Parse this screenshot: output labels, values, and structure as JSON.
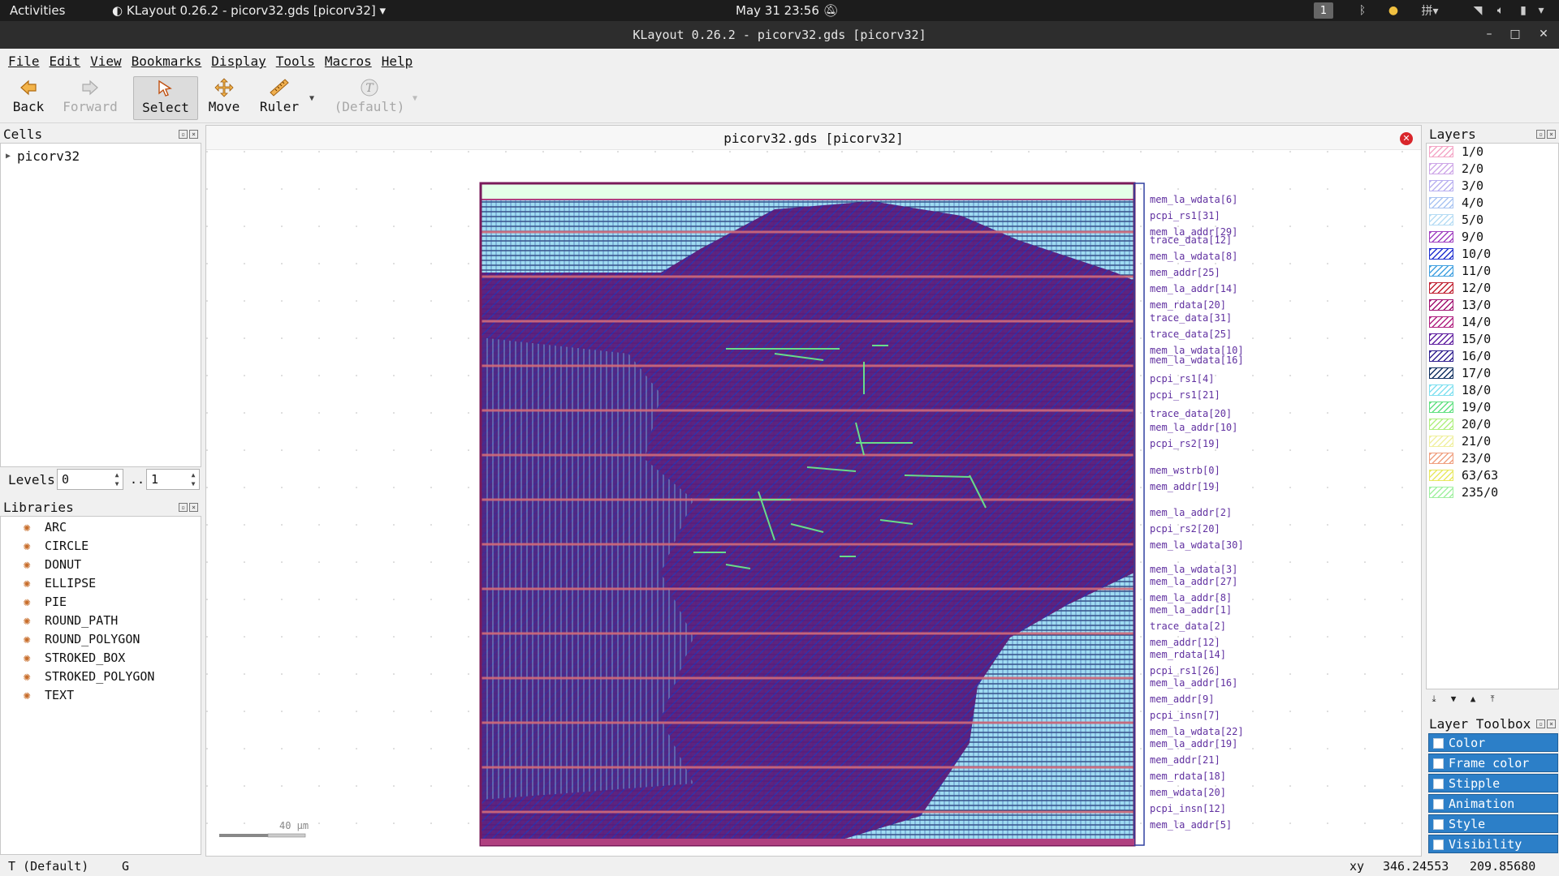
{
  "topbar": {
    "activities": "Activities",
    "app_name": "KLayout 0.26.2 - picorv32.gds [picorv32]",
    "clock": "May 31 23:56",
    "workspace": "1"
  },
  "window": {
    "title": "KLayout 0.26.2 - picorv32.gds [picorv32]"
  },
  "menu": [
    {
      "label": "File"
    },
    {
      "label": "Edit"
    },
    {
      "label": "View"
    },
    {
      "label": "Bookmarks"
    },
    {
      "label": "Display"
    },
    {
      "label": "Tools"
    },
    {
      "label": "Macros"
    },
    {
      "label": "Help"
    }
  ],
  "toolbar": {
    "back": "Back",
    "forward": "Forward",
    "select": "Select",
    "move": "Move",
    "ruler": "Ruler",
    "default": "(Default)"
  },
  "cells": {
    "title": "Cells",
    "items": [
      "picorv32"
    ]
  },
  "levels": {
    "label": "Levels",
    "from": "0",
    "sep": "..",
    "to": "1"
  },
  "libraries": {
    "title": "Libraries",
    "items": [
      "ARC",
      "CIRCLE",
      "DONUT",
      "ELLIPSE",
      "PIE",
      "ROUND_PATH",
      "ROUND_POLYGON",
      "STROKED_BOX",
      "STROKED_POLYGON",
      "TEXT"
    ]
  },
  "view": {
    "title": "picorv32.gds [picorv32]",
    "scale_label": "40 µm",
    "pin_labels": [
      "mem_la_wdata[6]",
      "pcpi_rs1[31]",
      "mem_la_addr[29]",
      "trace_data[12]",
      "mem_la_wdata[8]",
      "mem_addr[25]",
      "mem_la_addr[14]",
      "mem_rdata[20]",
      "trace_data[31]",
      "trace_data[25]",
      "mem_la_wdata[10]",
      "mem_la_wdata[16]",
      "pcpi_rs1[4]",
      "pcpi_rs1[21]",
      "trace_data[20]",
      "mem_la_addr[10]",
      "pcpi_rs2[19]",
      "mem_wstrb[0]",
      "mem_addr[19]",
      "mem_la_addr[2]",
      "pcpi_rs2[20]",
      "mem_la_wdata[30]",
      "mem_la_wdata[3]",
      "mem_la_addr[27]",
      "mem_la_addr[8]",
      "mem_la_addr[1]",
      "trace_data[2]",
      "mem_addr[12]",
      "mem_rdata[14]",
      "pcpi_rs1[26]",
      "mem_la_addr[16]",
      "mem_addr[9]",
      "pcpi_insn[7]",
      "mem_la_wdata[22]",
      "mem_la_addr[19]",
      "mem_addr[21]",
      "mem_rdata[18]",
      "mem_wdata[20]",
      "pcpi_insn[12]",
      "mem_la_addr[5]"
    ]
  },
  "layers": {
    "title": "Layers",
    "items": [
      {
        "name": "1/0",
        "color": "#f4a6c6"
      },
      {
        "name": "2/0",
        "color": "#cfa8e8"
      },
      {
        "name": "3/0",
        "color": "#b9b0f0"
      },
      {
        "name": "4/0",
        "color": "#a9c4f2"
      },
      {
        "name": "5/0",
        "color": "#b6dcf4"
      },
      {
        "name": "9/0",
        "color": "#a040c0"
      },
      {
        "name": "10/0",
        "color": "#2030d0"
      },
      {
        "name": "11/0",
        "color": "#40a0e0"
      },
      {
        "name": "12/0",
        "color": "#c02030"
      },
      {
        "name": "13/0",
        "color": "#a01070"
      },
      {
        "name": "14/0",
        "color": "#b02080"
      },
      {
        "name": "15/0",
        "color": "#6020a0"
      },
      {
        "name": "16/0",
        "color": "#302090"
      },
      {
        "name": "17/0",
        "color": "#103060"
      },
      {
        "name": "18/0",
        "color": "#80e0f0"
      },
      {
        "name": "19/0",
        "color": "#60e080"
      },
      {
        "name": "20/0",
        "color": "#b0f080"
      },
      {
        "name": "21/0",
        "color": "#f0f0a0"
      },
      {
        "name": "23/0",
        "color": "#f0a080"
      },
      {
        "name": "63/63",
        "color": "#e8e860"
      },
      {
        "name": "235/0",
        "color": "#a0f0a0"
      }
    ]
  },
  "toolbox": {
    "title": "Layer Toolbox",
    "items": [
      "Color",
      "Frame color",
      "Stipple",
      "Animation",
      "Style",
      "Visibility"
    ]
  },
  "status": {
    "mode": "T (Default)",
    "grid": "G",
    "coord_label": "xy",
    "x": "346.24553",
    "y": "209.85680"
  },
  "colors": {
    "accent": "#2c7fc8",
    "layout_purple": "#5a1a7a",
    "layout_cyan": "#7fd4f0",
    "layout_green": "#6cf08a"
  }
}
